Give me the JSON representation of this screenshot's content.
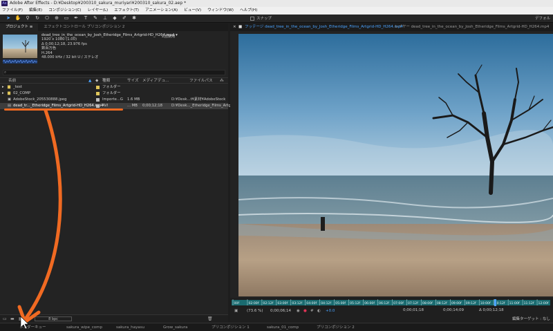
{
  "window": {
    "app_icon": "Ae",
    "title": "Adobe After Effects - D:¥Desktop¥200310_sakura_muriyari¥200310_sakura_02.aep *"
  },
  "menu": [
    "ファイル(F)",
    "編集(E)",
    "コンポジション(C)",
    "レイヤー(L)",
    "エフェクト(T)",
    "アニメーション(A)",
    "ビュー(V)",
    "ウィンドウ(W)",
    "ヘルプ(H)"
  ],
  "toolbar": {
    "snap_label": "スナップ",
    "workspace_label": "デフォル"
  },
  "project_panel": {
    "tabs": [
      "プロジェクト ≡",
      "エフェクトコントロール プリコンポジション 2"
    ],
    "footage_info": {
      "filename": "dead_tree_in_the_ocean_by_Josh_Etheridge_Films_Artgrid-HD_H264.mp4 ▾",
      "usage": "2回使用",
      "resolution": "1920 x 1080 (1.00)",
      "duration": "Δ 0;00;12;18, 23.976 fps",
      "color": "数百万色",
      "codec": "H.264",
      "audio": "48.000 kHz / 32 bit U / ステレオ"
    },
    "search_placeholder": "",
    "columns": {
      "name": "名前",
      "label": "",
      "type": "種類",
      "size": "サイズ",
      "duration": "メディアデュ...",
      "path": "ファイルパス"
    },
    "items": [
      {
        "expander": "▸",
        "name": "_test",
        "type": "フォルダー",
        "size": "",
        "duration": "",
        "path": "",
        "color": "#e0c65a",
        "selected": false
      },
      {
        "expander": "▸",
        "name": "02_COMP",
        "type": "フォルダー",
        "size": "",
        "duration": "",
        "path": "",
        "color": "#e0c65a",
        "selected": false
      },
      {
        "expander": "",
        "name": "AdobeStock_205530888.jpeg",
        "type": "Importe...G",
        "size": "1.6 MB",
        "duration": "",
        "path": "D:¥Desk...t¥素材¥AdobeStock",
        "color": "#bdbdbd",
        "selected": false
      },
      {
        "expander": "",
        "name": "dead_tr..._Etheridge_Films_Artgrid-HD_H264.mp4",
        "type": "AVI",
        "size": "... MB",
        "duration": "0;00;12;18",
        "path": "D:¥Desk..._Etheridge_Films_Artgr",
        "color": "#bdbdbd",
        "selected": true
      }
    ],
    "bpc": "8 bpc"
  },
  "viewer": {
    "tab_footage": "フッテージ dead_tree_in_the_ocean_by_Josh_Etheridge_Films_Artgrid-HD_H264.mp4",
    "tab_layer": "レイヤー dead_tree_in_the_ocean_by_Josh_Etheridge_Films_Artgrid-HD_H264.mp4",
    "ruler_ticks": [
      "00f",
      "02:00f",
      "02:12f",
      "03:00f",
      "03:12f",
      "04:00f",
      "04:12f",
      "05:00f",
      "05:12f",
      "06:00f",
      "06:12f",
      "07:00f",
      "07:12f",
      "08:00f",
      "08:12f",
      "09:00f",
      "09:12f",
      "10:00f",
      "10:12f",
      "11:00f",
      "11:12f",
      "12:00f"
    ],
    "zoom": "(73.6 %)",
    "timecode_in": "0;00;06;14",
    "timecode_current": "0;00;01;18",
    "timecode_out": "0;00;14;09",
    "timecode_duration": "Δ 0;00;12;18",
    "exposure": "+0.0",
    "edit_target": "編集ターゲット : なし"
  },
  "bottom_tabs": [
    "レンダーキュー",
    "sakura_wipe_comp",
    "sakura_hayasu",
    "Grow_sakura",
    "プリコンポジション 1",
    "sakura_01_comp",
    "プリコンポジション 2"
  ]
}
